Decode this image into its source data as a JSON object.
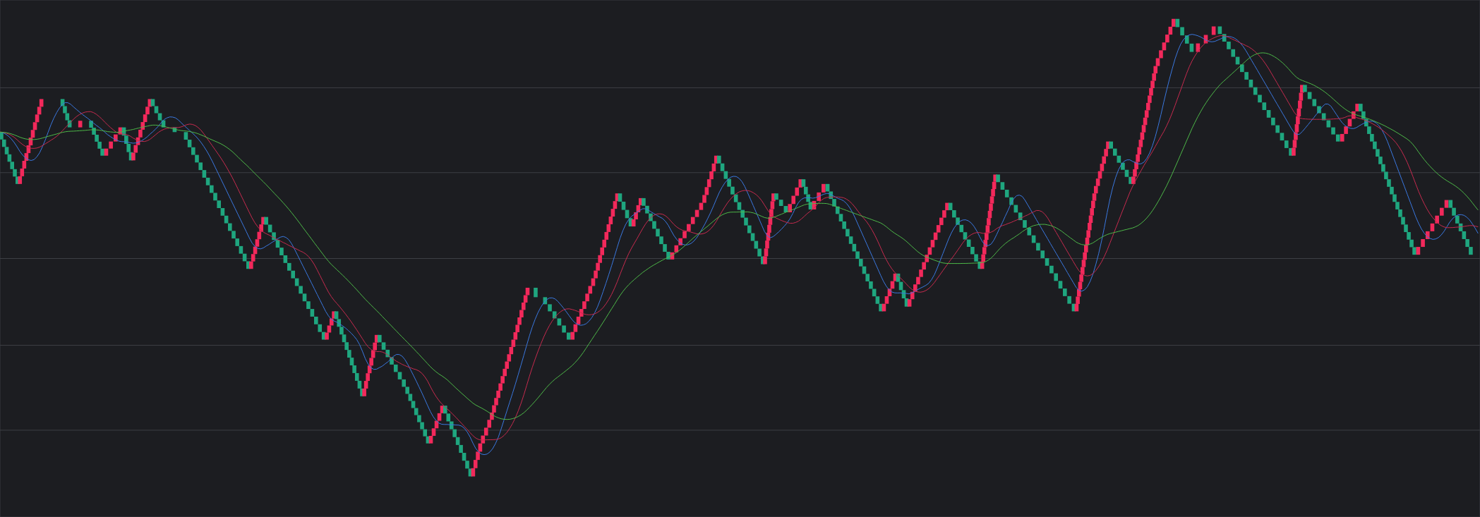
{
  "chart": {
    "brick_kinds": [
      {
        "kind": "rising",
        "color": "#f2295b"
      },
      {
        "kind": "falling",
        "color": "#1fa67f"
      }
    ],
    "moving_averages": [
      {
        "kind": "fast",
        "color": "#3a78e0"
      },
      {
        "kind": "medium",
        "color": "#c62a4e"
      },
      {
        "kind": "slow",
        "color": "#4db848"
      }
    ]
  }
}
